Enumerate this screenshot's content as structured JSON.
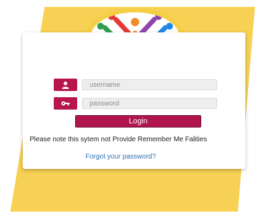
{
  "login": {
    "username_placeholder": "username",
    "password_placeholder": "password",
    "login_label": "Login",
    "note": "Please note this sytem not Provide Remember Me Falities",
    "forgot_link": "Forgot your password?"
  },
  "colors": {
    "background_yellow": "#f7d154",
    "accent": "#b0154e",
    "link": "#2d6db5"
  },
  "icons": {
    "username": "user-icon",
    "password": "key-icon",
    "logo": "people-circle-logo-icon"
  }
}
